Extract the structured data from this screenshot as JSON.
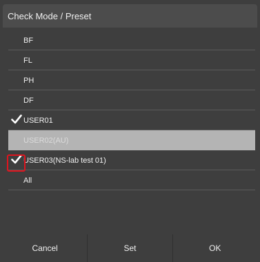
{
  "title": "Check Mode / Preset",
  "items": [
    {
      "label": "BF",
      "checked": false,
      "selected": false
    },
    {
      "label": "FL",
      "checked": false,
      "selected": false
    },
    {
      "label": "PH",
      "checked": false,
      "selected": false
    },
    {
      "label": "DF",
      "checked": false,
      "selected": false
    },
    {
      "label": "USER01",
      "checked": true,
      "selected": false
    },
    {
      "label": "USER02(AU)",
      "checked": false,
      "selected": true
    },
    {
      "label": "USER03(NS-lab test 01)",
      "checked": true,
      "selected": false
    },
    {
      "label": "All",
      "checked": false,
      "selected": false
    }
  ],
  "buttons": {
    "cancel": "Cancel",
    "set": "Set",
    "ok": "OK"
  },
  "colors": {
    "background": "#3e3e3e",
    "title_bar": "#4c4c4c",
    "selected_row": "#b4b4b4",
    "highlight": "#e0141e",
    "divider": "#5c5c5c"
  },
  "icons": {
    "check": "check-icon"
  }
}
